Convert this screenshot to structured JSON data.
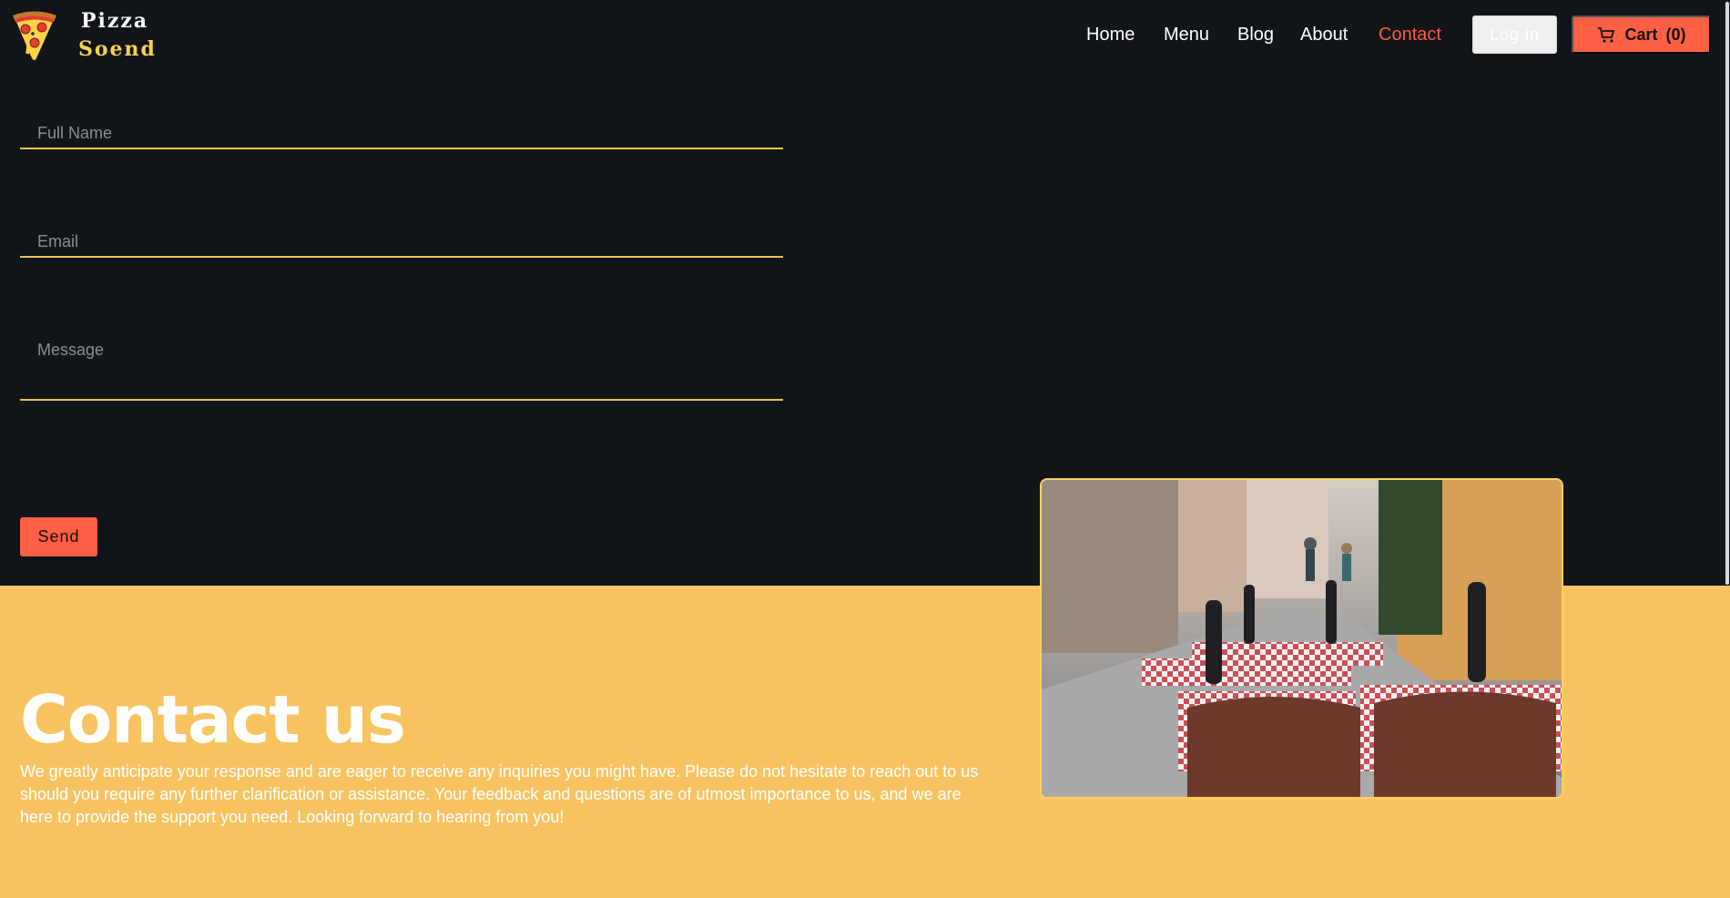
{
  "brand": {
    "line1": "Pizza",
    "line2": "Soend",
    "logo_icon": "pizza-icon"
  },
  "nav": {
    "items": [
      "Home",
      "Menu",
      "Blog",
      "About",
      "Contact"
    ],
    "active": "Contact",
    "login": "Log in",
    "cart_label": "Cart",
    "cart_count": "(0)",
    "cart_icon": "shopping-cart-icon"
  },
  "form": {
    "name_placeholder": "Full Name",
    "email_placeholder": "Email",
    "message_placeholder": "Message",
    "send": "Send"
  },
  "contact": {
    "title": "Contact us",
    "text": "We greatly anticipate your response and are eager to receive any inquiries you might have. Please do not hesitate to reach out to us should you require any further clarification or assistance. Your feedback and questions are of utmost importance to us, and we are here to provide the support you need. Looking forward to hearing from you!"
  },
  "colors": {
    "dark": "#111418",
    "accent": "#ff5f43",
    "gold": "#e7c44f",
    "yellow": "#f8c462"
  }
}
